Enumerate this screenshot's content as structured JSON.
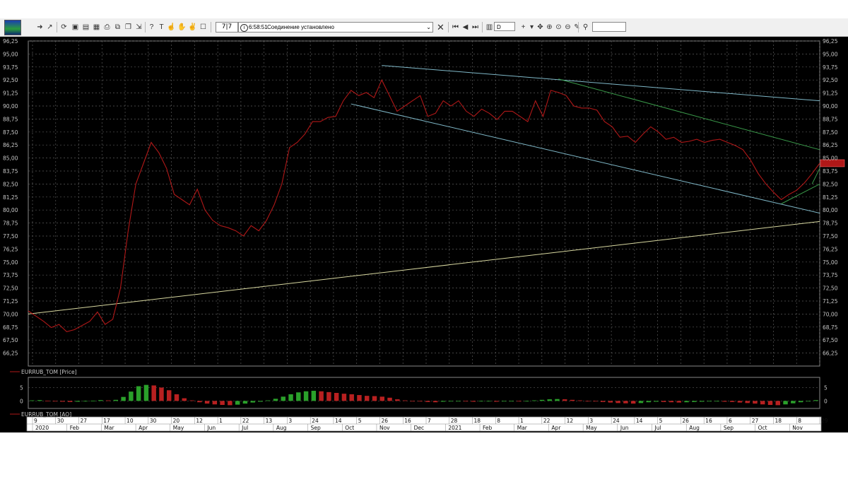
{
  "toolbar": {
    "counter": "7|7",
    "status_time": "6:58:51",
    "status_text": "Соединение установлено",
    "period": "D",
    "search_placeholder": ""
  },
  "colors": {
    "background": "#000000",
    "grid": "#5a5a5a",
    "price_line": "#b01818",
    "trend_long": "#d8d8a0",
    "channel_lines": "#7fb8c8",
    "green_lines": "#3a9a4a",
    "ao_up": "#2aa02a",
    "ao_down": "#b82020",
    "axis_text": "#c8c8c8",
    "price_tag": "#b01818"
  },
  "chart_data": [
    {
      "type": "line",
      "series": [
        {
          "name": "EURRUB_TOM [Price]",
          "x": [
            "2019-12-09",
            "2019-12-16",
            "2019-12-23",
            "2019-12-30",
            "2020-01-06",
            "2020-01-13",
            "2020-01-20",
            "2020-01-27",
            "2020-02-03",
            "2020-02-10",
            "2020-02-17",
            "2020-02-24",
            "2020-03-02",
            "2020-03-09",
            "2020-03-16",
            "2020-03-23",
            "2020-03-30",
            "2020-04-06",
            "2020-04-13",
            "2020-04-20",
            "2020-04-27",
            "2020-05-04",
            "2020-05-11",
            "2020-05-18",
            "2020-05-25",
            "2020-06-01",
            "2020-06-08",
            "2020-06-15",
            "2020-06-22",
            "2020-06-29",
            "2020-07-06",
            "2020-07-13",
            "2020-07-20",
            "2020-07-27",
            "2020-08-03",
            "2020-08-10",
            "2020-08-17",
            "2020-08-24",
            "2020-08-31",
            "2020-09-07",
            "2020-09-14",
            "2020-09-21",
            "2020-09-28",
            "2020-10-05",
            "2020-10-12",
            "2020-10-19",
            "2020-10-26",
            "2020-11-02",
            "2020-11-09",
            "2020-11-16",
            "2020-11-23",
            "2020-11-30",
            "2020-12-07",
            "2020-12-14",
            "2020-12-21",
            "2020-12-28",
            "2021-01-04",
            "2021-01-11",
            "2021-01-18",
            "2021-01-25",
            "2021-02-01",
            "2021-02-08",
            "2021-02-15",
            "2021-02-22",
            "2021-03-01",
            "2021-03-08",
            "2021-03-15",
            "2021-03-22",
            "2021-03-29",
            "2021-04-05",
            "2021-04-12",
            "2021-04-19",
            "2021-04-26",
            "2021-05-03",
            "2021-05-10",
            "2021-05-17",
            "2021-05-24",
            "2021-05-31",
            "2021-06-07",
            "2021-06-14",
            "2021-06-21",
            "2021-06-28",
            "2021-07-05",
            "2021-07-12",
            "2021-07-19",
            "2021-07-26",
            "2021-08-02",
            "2021-08-09",
            "2021-08-16",
            "2021-08-23",
            "2021-08-30",
            "2021-09-06",
            "2021-09-13",
            "2021-09-20",
            "2021-09-27",
            "2021-10-04",
            "2021-10-11",
            "2021-10-18",
            "2021-10-25",
            "2021-11-01",
            "2021-11-08",
            "2021-11-15",
            "2021-11-22",
            "2021-11-29"
          ],
          "values": [
            70.3,
            69.8,
            69.3,
            68.7,
            69.0,
            68.3,
            68.5,
            68.9,
            69.3,
            70.2,
            69.0,
            69.5,
            72.5,
            78.0,
            82.5,
            84.5,
            86.5,
            85.5,
            84.0,
            81.5,
            81.0,
            80.5,
            82.0,
            80.0,
            79.0,
            78.5,
            78.3,
            78.0,
            77.5,
            78.5,
            78.0,
            79.0,
            80.5,
            82.5,
            86.0,
            86.5,
            87.3,
            88.5,
            88.5,
            88.9,
            89.0,
            90.5,
            91.5,
            91.0,
            91.3,
            90.8,
            92.5,
            91.0,
            89.5,
            90.0,
            90.5,
            91.0,
            89.0,
            89.3,
            90.5,
            90.0,
            90.5,
            89.5,
            89.0,
            89.7,
            89.3,
            88.7,
            89.5,
            89.5,
            89.0,
            88.5,
            90.5,
            89.0,
            91.5,
            91.3,
            91.0,
            90.0,
            89.8,
            89.8,
            89.6,
            88.5,
            88.0,
            87.0,
            87.1,
            86.5,
            87.3,
            88.0,
            87.5,
            86.8,
            87.0,
            86.5,
            86.6,
            86.8,
            86.5,
            86.7,
            86.8,
            86.5,
            86.2,
            85.8,
            84.8,
            83.5,
            82.5,
            81.7,
            81.0,
            81.5,
            81.9,
            82.6,
            83.5,
            84.5
          ]
        }
      ],
      "xlabel": "",
      "ylabel": "",
      "ylim": [
        65.0,
        96.25
      ],
      "ytick_labels": [
        "66,25",
        "67,50",
        "68,75",
        "70,00",
        "71,25",
        "72,50",
        "73,75",
        "75,00",
        "76,25",
        "77,50",
        "78,75",
        "80,00",
        "81,25",
        "82,50",
        "83,75",
        "85,00",
        "86,25",
        "87,50",
        "88,75",
        "90,00",
        "91,25",
        "92,50",
        "93,75",
        "95,00",
        "96,25"
      ],
      "ytick_values": [
        66.25,
        67.5,
        68.75,
        70.0,
        71.25,
        72.5,
        73.75,
        75.0,
        76.25,
        77.5,
        78.75,
        80.0,
        81.25,
        82.5,
        83.75,
        85.0,
        86.25,
        87.5,
        88.75,
        90.0,
        91.25,
        92.5,
        93.75,
        95.0,
        96.25
      ],
      "last_price_tag": "",
      "trend_lines": [
        {
          "name": "support",
          "from": {
            "x": "2019-12-09",
            "y": 70.0
          },
          "to": {
            "x": "2021-11-29",
            "y": 78.9
          }
        },
        {
          "name": "channel-top",
          "from": {
            "x": "2020-10-26",
            "y": 93.9
          },
          "to": {
            "x": "2021-11-29",
            "y": 90.5
          }
        },
        {
          "name": "channel-bottom",
          "from": {
            "x": "2020-09-28",
            "y": 90.2
          },
          "to": {
            "x": "2021-11-29",
            "y": 79.7
          }
        },
        {
          "name": "green-top",
          "from": {
            "x": "2021-04-05",
            "y": 92.6
          },
          "to": {
            "x": "2021-11-29",
            "y": 85.8
          }
        },
        {
          "name": "green-up-1",
          "from": {
            "x": "2021-10-25",
            "y": 80.6
          },
          "to": {
            "x": "2021-11-29",
            "y": 82.5
          }
        },
        {
          "name": "green-up-2",
          "from": {
            "x": "2021-11-22",
            "y": 82.5
          },
          "to": {
            "x": "2021-11-29",
            "y": 84.0
          }
        }
      ],
      "grid": true
    },
    {
      "type": "bar",
      "series": [
        {
          "name": "EURRUB_TOM [AO]",
          "values": [
            0.2,
            0.3,
            0.1,
            -0.2,
            -0.3,
            -0.4,
            -0.3,
            -0.2,
            0.1,
            0.3,
            0.2,
            0.4,
            1.5,
            3.5,
            5.5,
            6.0,
            5.8,
            5.0,
            4.0,
            2.5,
            1.0,
            0.2,
            -0.5,
            -1.0,
            -1.3,
            -1.5,
            -1.6,
            -1.4,
            -1.0,
            -0.6,
            -0.3,
            0.2,
            0.8,
            1.6,
            2.5,
            3.2,
            3.6,
            3.8,
            3.6,
            3.3,
            3.0,
            2.7,
            2.5,
            2.2,
            1.9,
            1.8,
            1.6,
            1.2,
            0.6,
            0.2,
            -0.1,
            -0.2,
            -0.4,
            -0.5,
            -0.3,
            -0.2,
            -0.1,
            -0.2,
            -0.3,
            -0.2,
            -0.2,
            -0.3,
            -0.2,
            -0.1,
            -0.2,
            -0.2,
            0.2,
            0.4,
            0.6,
            0.7,
            0.6,
            0.4,
            0.2,
            0.0,
            -0.2,
            -0.4,
            -0.6,
            -0.8,
            -0.9,
            -1.0,
            -0.8,
            -0.5,
            -0.3,
            -0.4,
            -0.5,
            -0.6,
            -0.5,
            -0.4,
            -0.3,
            -0.2,
            -0.2,
            -0.3,
            -0.4,
            -0.6,
            -0.8,
            -1.0,
            -1.3,
            -1.5,
            -1.6,
            -1.3,
            -0.9,
            -0.5,
            -0.1,
            0.3
          ]
        }
      ],
      "ylim": [
        -1.5,
        7.5
      ],
      "ytick_labels": [
        "5",
        "0"
      ],
      "ytick_values": [
        5,
        0
      ]
    }
  ],
  "xaxis": {
    "day_ticks": [
      "9",
      "30",
      "27",
      "17",
      "10",
      "30",
      "20",
      "12",
      "1",
      "22",
      "13",
      "3",
      "24",
      "14",
      "5",
      "26",
      "16",
      "7",
      "28",
      "18",
      "8",
      "1",
      "22",
      "12",
      "3",
      "24",
      "14",
      "5",
      "26",
      "16",
      "6",
      "27",
      "18",
      "8",
      "29"
    ],
    "month_labels": [
      "2020",
      "Feb",
      "Mar",
      "Apr",
      "May",
      "Jun",
      "Jul",
      "Aug",
      "Sep",
      "Oct",
      "Nov",
      "Dec",
      "2021",
      "Feb",
      "Mar",
      "Apr",
      "May",
      "Jun",
      "Jul",
      "Aug",
      "Sep",
      "Oct",
      "Nov"
    ]
  }
}
